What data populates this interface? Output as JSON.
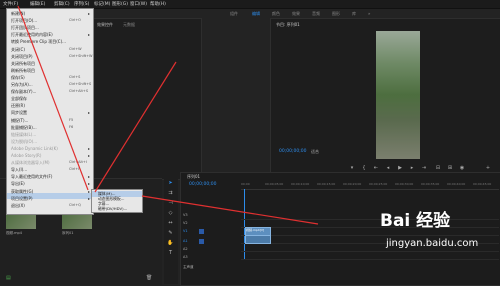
{
  "menubar": {
    "items": [
      "文件(F)",
      "编辑(E)",
      "剪辑(C)",
      "序列(S)",
      "标记(M)",
      "图形(G)",
      "窗口(W)",
      "帮助(H)"
    ]
  },
  "workspace_tabs": [
    "组件",
    "编辑",
    "颜色",
    "效果",
    "音频",
    "图形",
    "库",
    "»"
  ],
  "source_panel": {
    "tabs": [
      "效果控件",
      "元数据"
    ]
  },
  "program_panel": {
    "title": "节目: 序列01",
    "timecode": "00;00;00;00",
    "fit": "适合"
  },
  "file_menu": {
    "items": [
      {
        "label": "新建(N)",
        "shortcut": "",
        "arrow": true,
        "disabled": false
      },
      {
        "label": "打开项目(O)...",
        "shortcut": "Ctrl+O",
        "arrow": false,
        "disabled": false
      },
      {
        "label": "打开团队项目...",
        "shortcut": "",
        "arrow": false,
        "disabled": false
      },
      {
        "label": "打开最近使用的内容(E)",
        "shortcut": "",
        "arrow": true,
        "disabled": false
      },
      {
        "label": "转换 Premiere Clip 项目(C)...",
        "shortcut": "",
        "arrow": false,
        "disabled": false
      },
      {
        "label": "关闭(C)",
        "shortcut": "Ctrl+W",
        "arrow": false,
        "disabled": false
      },
      {
        "label": "关闭项目(P)",
        "shortcut": "Ctrl+Shift+W",
        "arrow": false,
        "disabled": false
      },
      {
        "label": "关闭所有项目",
        "shortcut": "",
        "arrow": false,
        "disabled": false
      },
      {
        "label": "刷新所有项目",
        "shortcut": "",
        "arrow": false,
        "disabled": false
      },
      {
        "label": "保存(S)",
        "shortcut": "Ctrl+S",
        "arrow": false,
        "disabled": false
      },
      {
        "label": "另存为(A)...",
        "shortcut": "Ctrl+Shift+S",
        "arrow": false,
        "disabled": false
      },
      {
        "label": "保存副本(Y)...",
        "shortcut": "Ctrl+Alt+S",
        "arrow": false,
        "disabled": false
      },
      {
        "label": "全部保存",
        "shortcut": "",
        "arrow": false,
        "disabled": false
      },
      {
        "label": "还原(R)",
        "shortcut": "",
        "arrow": false,
        "disabled": false
      },
      {
        "label": "同步设置",
        "shortcut": "",
        "arrow": true,
        "disabled": false
      },
      {
        "label": "捕捉(T)...",
        "shortcut": "F5",
        "arrow": false,
        "disabled": false
      },
      {
        "label": "批量捕捉(B)...",
        "shortcut": "F6",
        "arrow": false,
        "disabled": false
      },
      {
        "label": "链接媒体(L)...",
        "shortcut": "",
        "arrow": false,
        "disabled": true
      },
      {
        "label": "设为脱机(O)...",
        "shortcut": "",
        "arrow": false,
        "disabled": true
      },
      {
        "label": "Adobe Dynamic Link(K)",
        "shortcut": "",
        "arrow": true,
        "disabled": true
      },
      {
        "label": "Adobe Story(R)",
        "shortcut": "",
        "arrow": true,
        "disabled": true
      },
      {
        "label": "从媒体浏览器导入(M)",
        "shortcut": "Ctrl+Alt+I",
        "arrow": false,
        "disabled": true
      },
      {
        "label": "导入(I)...",
        "shortcut": "Ctrl+I",
        "arrow": false,
        "disabled": false
      },
      {
        "label": "导入最近使用的文件(F)",
        "shortcut": "",
        "arrow": true,
        "disabled": false
      },
      {
        "label": "导出(E)",
        "shortcut": "",
        "arrow": true,
        "disabled": false
      },
      {
        "label": "获取属性(G)",
        "shortcut": "",
        "arrow": true,
        "disabled": false
      },
      {
        "label": "项目设置(P)",
        "shortcut": "",
        "arrow": true,
        "disabled": false
      },
      {
        "label": "退出(X)",
        "shortcut": "Ctrl+Q",
        "arrow": false,
        "disabled": false
      }
    ]
  },
  "export_submenu": {
    "items": [
      "媒体(M)...",
      "动态图形模板...",
      "字幕...",
      "磁带(DV/HDV)..."
    ]
  },
  "timeline": {
    "title": "序列01",
    "timecode": "00;00;00;00",
    "ruler": [
      "00;00",
      "00;00;05;00",
      "00;00;10;00",
      "00;00;15;00",
      "00;00;20;00",
      "00;00;25;00",
      "00;00;30;00",
      "00;00;35;00",
      "00;00;40;00",
      "00;00;45;00"
    ],
    "tracks": [
      "V3",
      "V2",
      "V1",
      "A1",
      "A2",
      "A3",
      "主声道"
    ],
    "clip_label": "视频.mp4[V]"
  },
  "project_panel": {
    "items": [
      "视频.mp4",
      "序列01"
    ]
  },
  "watermark": {
    "brand": "Bai 经验",
    "url": "jingyan.baidu.com"
  },
  "colors": {
    "accent": "#2d8ceb",
    "arrow": "#e03030",
    "menu_bg": "#e7e7e7",
    "menu_highlight": "#b6cde8"
  }
}
